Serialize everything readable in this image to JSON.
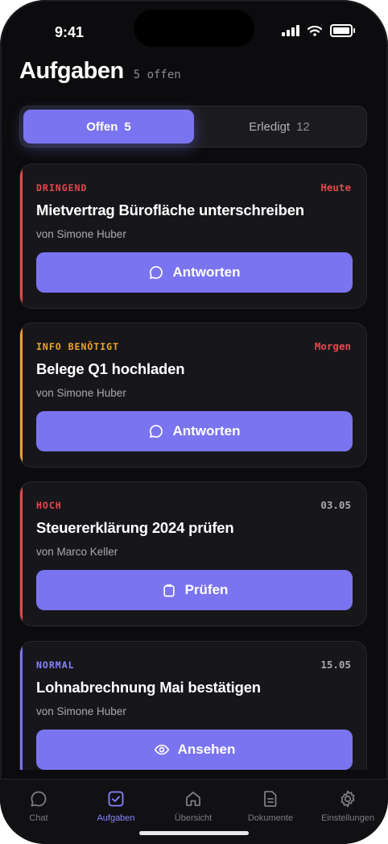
{
  "status_bar": {
    "time": "9:41"
  },
  "header": {
    "title": "Aufgaben",
    "open_count": "5 offen"
  },
  "segments": [
    {
      "label": "Offen",
      "count": "5",
      "active": true
    },
    {
      "label": "Erledigt",
      "count": "12",
      "active": false
    }
  ],
  "tasks": [
    {
      "tag": "DRINGEND",
      "tag_color": "#e5484d",
      "due": "Heute",
      "due_color": "#e5484d",
      "title": "Mietvertrag Bürofläche unterschreiben",
      "assignee": "von Simone Huber",
      "action_label": "Antworten",
      "action_icon": "chat-bubble-icon",
      "accent": "#e5484d"
    },
    {
      "tag": "INFO BENÖTIGT",
      "tag_color": "#f0a32e",
      "due": "Morgen",
      "due_color": "#e5484d",
      "title": "Belege Q1 hochladen",
      "assignee": "von Simone Huber",
      "action_label": "Antworten",
      "action_icon": "chat-bubble-icon",
      "accent": "#f0a32e"
    },
    {
      "tag": "HOCH",
      "tag_color": "#e5484d",
      "due": "03.05",
      "due_color": "#a8a8b0",
      "title": "Steuererklärung 2024 prüfen",
      "assignee": "von Marco Keller",
      "action_label": "Prüfen",
      "action_icon": "clipboard-icon",
      "accent": "#e5484d"
    },
    {
      "tag": "NORMAL",
      "tag_color": "#8a84ff",
      "due": "15.05",
      "due_color": "#a8a8b0",
      "title": "Lohnabrechnung Mai bestätigen",
      "assignee": "von Simone Huber",
      "action_label": "Ansehen",
      "action_icon": "eye-icon",
      "accent": "#7b74f0"
    }
  ],
  "tabbar": [
    {
      "label": "Chat",
      "icon": "chat-icon",
      "active": false
    },
    {
      "label": "Aufgaben",
      "icon": "checkbox-icon",
      "active": true
    },
    {
      "label": "Übersicht",
      "icon": "home-icon",
      "active": false
    },
    {
      "label": "Dokumente",
      "icon": "document-icon",
      "active": false
    },
    {
      "label": "Einstellungen",
      "icon": "gear-icon",
      "active": false
    }
  ],
  "colors": {
    "accent": "#7b74f0",
    "background": "#0c0c0e",
    "card": "#17171b"
  }
}
